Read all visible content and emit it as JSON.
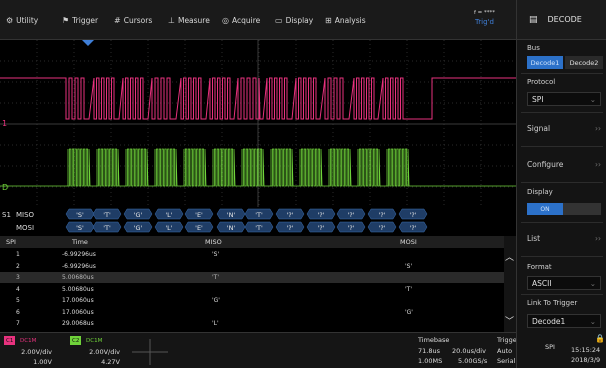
{
  "menu": {
    "items": [
      {
        "name": "menu-utility",
        "icon": "settings-icon",
        "glyph": "⚙",
        "label": "Utility"
      },
      {
        "name": "menu-trigger",
        "icon": "trigger-icon",
        "glyph": "⚑",
        "label": "Trigger"
      },
      {
        "name": "menu-cursors",
        "icon": "cursors-icon",
        "glyph": "#",
        "label": "Cursors"
      },
      {
        "name": "menu-measure",
        "icon": "measure-icon",
        "glyph": "⊥",
        "label": "Measure"
      },
      {
        "name": "menu-acquire",
        "icon": "acquire-icon",
        "glyph": "◎",
        "label": "Acquire"
      },
      {
        "name": "menu-display",
        "icon": "display-icon",
        "glyph": "▭",
        "label": "Display"
      },
      {
        "name": "menu-analysis",
        "icon": "analysis-icon",
        "glyph": "⊞",
        "label": "Analysis"
      }
    ],
    "trigger_status": {
      "line1": "f = ****",
      "line2": "Trig'd"
    }
  },
  "panel": {
    "title": "DECODE",
    "bus_label": "Bus",
    "bus_options": [
      "Decode1",
      "Decode2"
    ],
    "protocol_label": "Protocol",
    "protocol_value": "SPI",
    "signal_label": "Signal",
    "configure_label": "Configure",
    "display_label": "Display",
    "display_toggle": "ON",
    "list_label": "List",
    "format_label": "Format",
    "format_value": "ASCII",
    "link_label": "Link To Trigger",
    "link_value": "Decode1"
  },
  "channels": {
    "ch1_marker": "1",
    "ch2_marker": "D",
    "colors": {
      "ch1": "#e8327e",
      "ch2": "#6fd23a",
      "accent": "#2c71c9",
      "trigger": "#3f7fd8"
    }
  },
  "decode": {
    "bus_marker": "S1",
    "miso_label": "MISO",
    "mosi_label": "MOSI",
    "miso_bytes": [
      "'S'",
      "'T'",
      "'G'",
      "'L'",
      "'E'",
      "'N'",
      "'T'",
      "'?'",
      "'?'",
      "'?'",
      "'?'",
      "'?'"
    ],
    "mosi_bytes": [
      "'S'",
      "'T'",
      "'G'",
      "'L'",
      "'E'",
      "'N'",
      "'T'",
      "'?'",
      "'?'",
      "'?'",
      "'?'",
      "'?'"
    ]
  },
  "table": {
    "headers": [
      "SPI",
      "Time",
      "MISO",
      "MOSI"
    ],
    "rows": [
      {
        "idx": "1",
        "time": "-6.99296us",
        "miso": "'S'",
        "mosi": ""
      },
      {
        "idx": "2",
        "time": "-6.99296us",
        "miso": "",
        "mosi": "'S'"
      },
      {
        "idx": "3",
        "time": "5.00680us",
        "miso": "'T'",
        "mosi": ""
      },
      {
        "idx": "4",
        "time": "5.00680us",
        "miso": "",
        "mosi": "'T'"
      },
      {
        "idx": "5",
        "time": "17.0060us",
        "miso": "'G'",
        "mosi": ""
      },
      {
        "idx": "6",
        "time": "17.0060us",
        "miso": "",
        "mosi": "'G'"
      },
      {
        "idx": "7",
        "time": "29.0068us",
        "miso": "'L'",
        "mosi": ""
      }
    ],
    "selected_row": 2
  },
  "bottom": {
    "c1_tag": "C1",
    "c1_cpl": "DC1M",
    "c1_scale": "2.00V/div",
    "c1_offset": "1.00V",
    "c2_tag": "C2",
    "c2_cpl": "DC1M",
    "c2_scale": "2.00V/div",
    "c2_offset": "4.27V",
    "timebase_label": "Timebase",
    "timebase_delay": "71.8us",
    "timebase_scale": "20.0us/div",
    "sample_points": "1.00MS",
    "sample_rate": "5.00GS/s",
    "trigger_label": "Trigger",
    "trigger_mode": "Auto",
    "trigger_type": "Serial",
    "trigger_source": "SPI",
    "time": "15:15:24",
    "date": "2018/3/9"
  }
}
